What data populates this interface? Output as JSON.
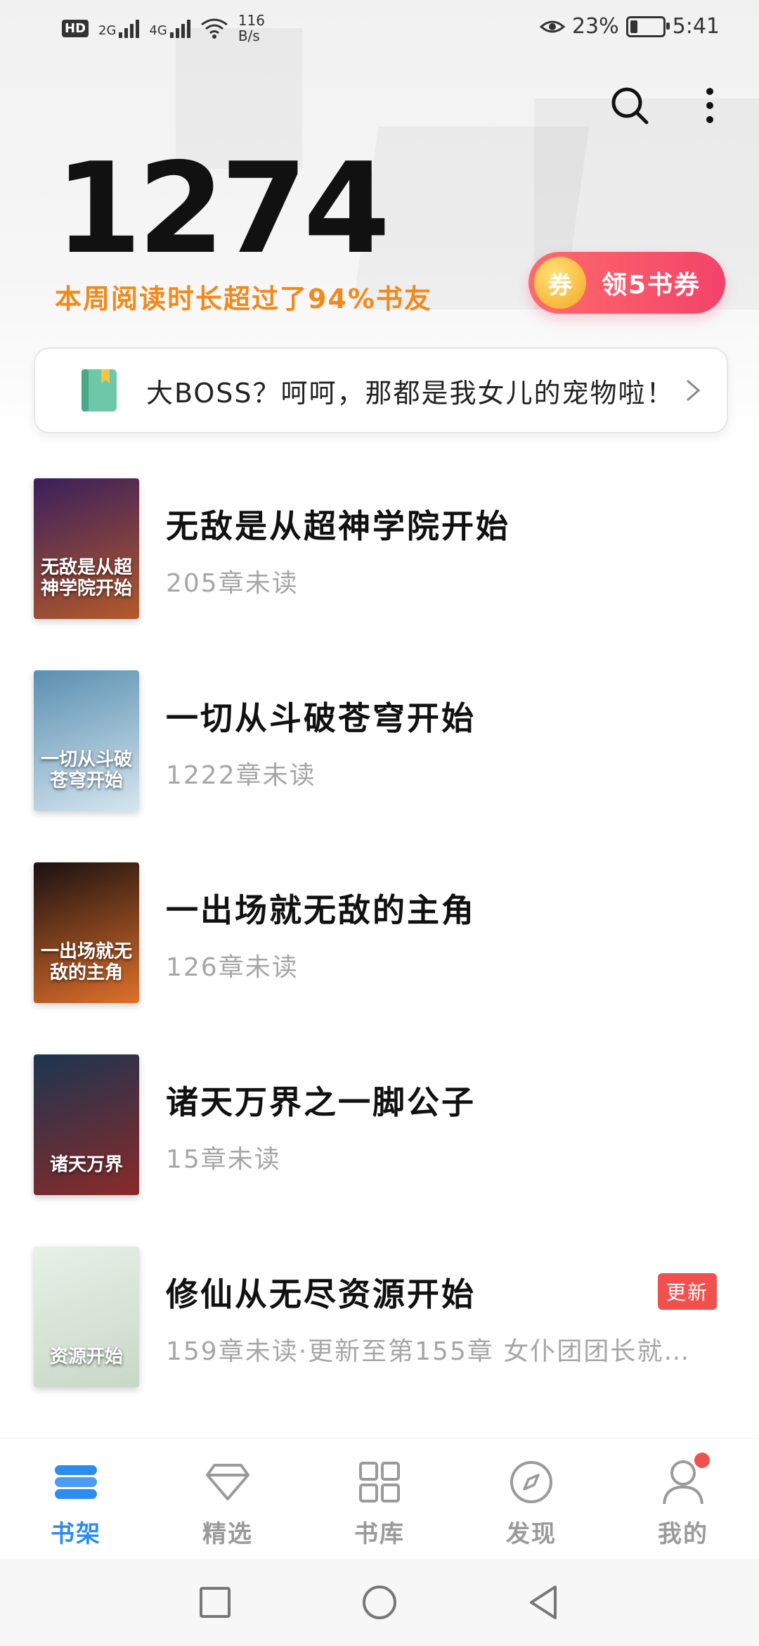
{
  "status_bar": {
    "hd": "HD",
    "net_2g": "2G",
    "net_4g": "4G",
    "speed_value": "116",
    "speed_unit": "B/s",
    "battery_percent": "23%",
    "time": "5:41",
    "battery_level": 0.23
  },
  "header": {
    "reading_minutes": "1274",
    "reading_summary": "本周阅读时长超过了94%书友",
    "coupon_icon_text": "券",
    "coupon_label": "领5书券",
    "search_icon": "search-icon",
    "more_icon": "more-vertical-icon"
  },
  "now_reading": {
    "text": "大BOSS？呵呵，那都是我女儿的宠物啦！",
    "icon": "bookmark-book-icon"
  },
  "books": [
    {
      "title": "无敌是从超神学院开始",
      "meta": "205章未读",
      "cover_text": "无敌是从超神学院开始",
      "cover_colors": [
        "#3a1f5c",
        "#b45a2a"
      ]
    },
    {
      "title": "一切从斗破苍穹开始",
      "meta": "1222章未读",
      "cover_text": "一切从斗破苍穹开始",
      "cover_colors": [
        "#5a8fb0",
        "#d6e6f0"
      ]
    },
    {
      "title": "一出场就无敌的主角",
      "meta": "126章未读",
      "cover_text": "一出场就无敌的主角",
      "cover_colors": [
        "#1a1010",
        "#e0702a"
      ]
    },
    {
      "title": "诸天万界之一脚公子",
      "meta": "15章未读",
      "cover_text": "诸天万界",
      "cover_colors": [
        "#1c3550",
        "#8a2a2a"
      ]
    },
    {
      "title": "修仙从无尽资源开始",
      "meta": "159章未读·更新至第155章 女仆团团长就…",
      "cover_text": "资源开始",
      "cover_colors": [
        "#e8f0e8",
        "#c8d8c8"
      ],
      "badge": "更新"
    }
  ],
  "tabs": [
    {
      "label": "书架",
      "icon": "bookshelf-icon",
      "active": true
    },
    {
      "label": "精选",
      "icon": "diamond-icon",
      "active": false
    },
    {
      "label": "书库",
      "icon": "grid-icon",
      "active": false
    },
    {
      "label": "发现",
      "icon": "compass-icon",
      "active": false
    },
    {
      "label": "我的",
      "icon": "user-icon",
      "active": false,
      "dot": true
    }
  ],
  "nav": [
    {
      "icon": "recents-square-icon"
    },
    {
      "icon": "home-circle-icon"
    },
    {
      "icon": "back-triangle-icon"
    }
  ],
  "colors": {
    "accent_blue": "#2d8cf0",
    "accent_orange": "#f08a1d",
    "coupon_red": "#f2436a",
    "badge_red": "#f0514f"
  }
}
